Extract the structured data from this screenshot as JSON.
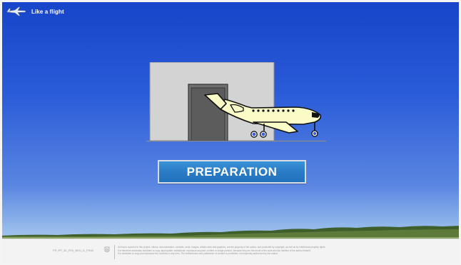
{
  "app": {
    "title": "Like a flight"
  },
  "main": {
    "button_label": "PREPARATION"
  },
  "footer": {
    "code": "FR_PP_30_FE0_NEU_D_FR40",
    "legal_line1": "All that is reported in this project, videos, documentation, contents, texts, images, artistic work and graphics, are the property of the author, and protected by copyright, as well as by intellectual property rights.",
    "legal_line2": "It is therefore absolutely forbidden to copy, appropriate, redistribute, reproduce any part, content or image present, because they are the result of the work and the intellect of the author himself.",
    "legal_line3": "It is forbidden to copy and reproduce the contents in any form.     The redistribution and publication of content is prohibited, not expressly authorized by the author."
  },
  "colors": {
    "sky_top": "#1744c9",
    "button": "#2a7cc6",
    "plane": "#fbfbc8",
    "wheels": "#3b5bd8"
  }
}
